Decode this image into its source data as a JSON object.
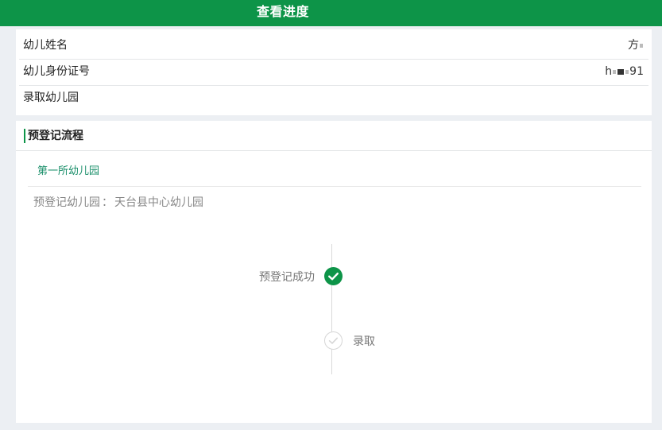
{
  "header": {
    "title": "查看进度"
  },
  "info": {
    "child_name_label": "幼儿姓名",
    "child_name_value": "方",
    "id_label": "幼儿身份证号",
    "id_value_prefix": "h",
    "id_value_suffix": "91",
    "admit_label": "录取幼儿园"
  },
  "flow": {
    "title": "预登记流程",
    "tab_first": "第一所幼儿园",
    "prereg_label": "预登记幼儿园",
    "prereg_sep": "：",
    "prereg_value": "天台县中心幼儿园",
    "steps": [
      {
        "label": "预登记成功",
        "status": "done",
        "icon": "check-circle-icon"
      },
      {
        "label": "录取",
        "status": "pending",
        "icon": "check-circle-outline-icon"
      }
    ]
  },
  "colors": {
    "brand": "#0d9448",
    "pending": "#d6d6d6"
  }
}
